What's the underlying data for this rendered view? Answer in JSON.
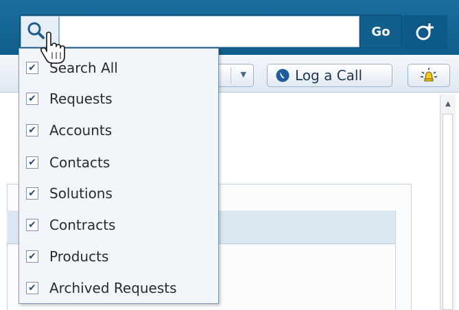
{
  "search": {
    "input_value": "",
    "go_label": "Go"
  },
  "toolbar": {
    "log_call_label": "Log a Call"
  },
  "search_scope_menu": {
    "items": [
      {
        "label": "Search All",
        "checked": true
      },
      {
        "label": "Requests",
        "checked": true
      },
      {
        "label": "Accounts",
        "checked": true
      },
      {
        "label": "Contacts",
        "checked": true
      },
      {
        "label": "Solutions",
        "checked": true
      },
      {
        "label": "Contracts",
        "checked": true
      },
      {
        "label": "Products",
        "checked": true
      },
      {
        "label": "Archived Requests",
        "checked": true
      }
    ]
  },
  "icons": {
    "search": "search-icon",
    "new_request": "add-request-icon",
    "phone": "phone-icon",
    "alert": "bell-alert-icon",
    "cursor": "hand-pointer-icon"
  },
  "colors": {
    "topbar": "#1a6f9e",
    "go_button": "#125f8e",
    "menu_bg": "#f2f6fb",
    "check": "#2b4d7a"
  }
}
